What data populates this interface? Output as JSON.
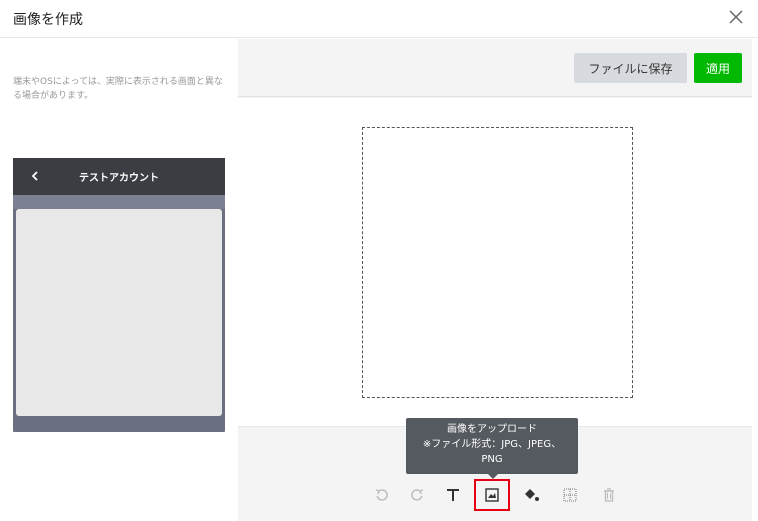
{
  "header": {
    "title": "画像を作成"
  },
  "left_panel": {
    "note": "端末やOSによっては、実際に表示される画面と異なる場合があります。",
    "phone": {
      "title": "テストアカウント"
    }
  },
  "toolbar": {
    "save_label": "ファイルに保存",
    "apply_label": "適用"
  },
  "tools": [
    {
      "name": "undo-icon"
    },
    {
      "name": "redo-icon"
    },
    {
      "name": "text-icon"
    },
    {
      "name": "image-upload-icon"
    },
    {
      "name": "fill-bucket-icon"
    },
    {
      "name": "grid-icon"
    },
    {
      "name": "trash-icon"
    }
  ],
  "tooltip": {
    "line1": "画像をアップロード",
    "line2": "※ファイル形式：JPG、JPEG、",
    "line3": "PNG"
  },
  "colors": {
    "apply": "#00b900",
    "highlight": "#e60012",
    "tooltip_bg": "#555a60"
  }
}
